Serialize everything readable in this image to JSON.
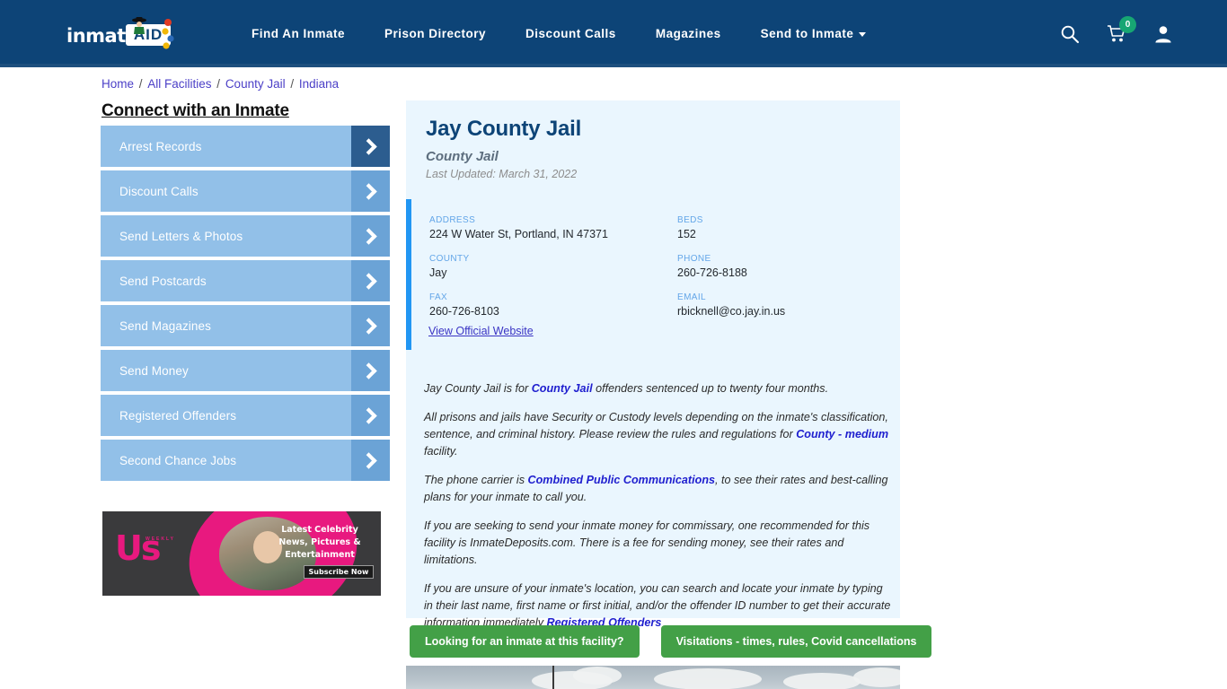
{
  "header": {
    "logo_text": "inmate",
    "logo_badge": "AID",
    "nav": [
      {
        "label": "Find An Inmate",
        "has_caret": false
      },
      {
        "label": "Prison Directory",
        "has_caret": false
      },
      {
        "label": "Discount Calls",
        "has_caret": false
      },
      {
        "label": "Magazines",
        "has_caret": false
      },
      {
        "label": "Send to Inmate",
        "has_caret": true
      }
    ],
    "icons": {
      "search": "search-icon",
      "cart": "cart-icon",
      "cart_count": "0",
      "account": "user-icon"
    },
    "colors": {
      "background": "#0d4477",
      "badge_green": "#17a673"
    }
  },
  "breadcrumb": {
    "items": [
      "Home",
      "All Facilities",
      "County Jail",
      "Indiana"
    ],
    "separator": "/"
  },
  "sidebar": {
    "title": "Connect with an Inmate",
    "items": [
      {
        "label": "Arrest Records",
        "active": true
      },
      {
        "label": "Discount Calls",
        "active": false
      },
      {
        "label": "Send Letters & Photos",
        "active": false
      },
      {
        "label": "Send Postcards",
        "active": false
      },
      {
        "label": "Send Magazines",
        "active": false
      },
      {
        "label": "Send Money",
        "active": false
      },
      {
        "label": "Registered Offenders",
        "active": false
      },
      {
        "label": "Second Chance Jobs",
        "active": false
      }
    ],
    "ad": {
      "brand": "Us",
      "brand_sub": "WEEKLY",
      "copy": "Latest Celebrity News, Pictures & Entertainment",
      "cta": "Subscribe Now"
    }
  },
  "facility": {
    "title": "Jay County Jail",
    "subtitle": "County Jail",
    "last_updated": "Last Updated: March 31, 2022",
    "info": [
      {
        "label": "ADDRESS",
        "value": "224 W Water St, Portland, IN 47371"
      },
      {
        "label": "BEDS",
        "value": "152"
      },
      {
        "label": "COUNTY",
        "value": "Jay"
      },
      {
        "label": "PHONE",
        "value": "260-726-8188"
      },
      {
        "label": "FAX",
        "value": "260-726-8103"
      },
      {
        "label": "EMAIL",
        "value": "rbicknell@co.jay.in.us"
      }
    ],
    "official_website_link": "View Official Website",
    "paragraphs": [
      {
        "parts": [
          {
            "t": "Jay County Jail is for ",
            "link": false
          },
          {
            "t": "County Jail",
            "link": true
          },
          {
            "t": " offenders sentenced up to twenty four months.",
            "link": false
          }
        ]
      },
      {
        "parts": [
          {
            "t": "All prisons and jails have Security or Custody levels depending on the inmate's classification, sentence, and criminal history. Please review the rules and regulations for ",
            "link": false
          },
          {
            "t": "County - medium",
            "link": true
          },
          {
            "t": " facility.",
            "link": false
          }
        ]
      },
      {
        "parts": [
          {
            "t": "The phone carrier is ",
            "link": false
          },
          {
            "t": "Combined Public Communications",
            "link": true
          },
          {
            "t": ", to see their rates and best-calling plans for your inmate to call you.",
            "link": false
          }
        ]
      },
      {
        "parts": [
          {
            "t": "If you are seeking to send your inmate money for commissary, one recommended for this facility is InmateDeposits.com. There is a fee for sending money, see their rates and limitations.",
            "link": false
          }
        ]
      },
      {
        "parts": [
          {
            "t": "If you are unsure of your inmate's location, you can search and locate your inmate by typing in their last name, first name or first initial, and/or the offender ID number to get their accurate information immediately ",
            "link": false
          },
          {
            "t": "Registered Offenders",
            "link": true
          }
        ]
      }
    ],
    "cta_buttons": [
      "Looking for an inmate at this facility?",
      "Visitations - times, rules, Covid cancellations"
    ]
  },
  "colors": {
    "panel_bg": "#eaf6fe",
    "accent_blue": "#2196f3",
    "cta_green": "#43a047",
    "sidebar_btn": "#92c0e8",
    "sidebar_arrow": "#6ba3d6",
    "sidebar_arrow_active": "#2c5d8f"
  }
}
